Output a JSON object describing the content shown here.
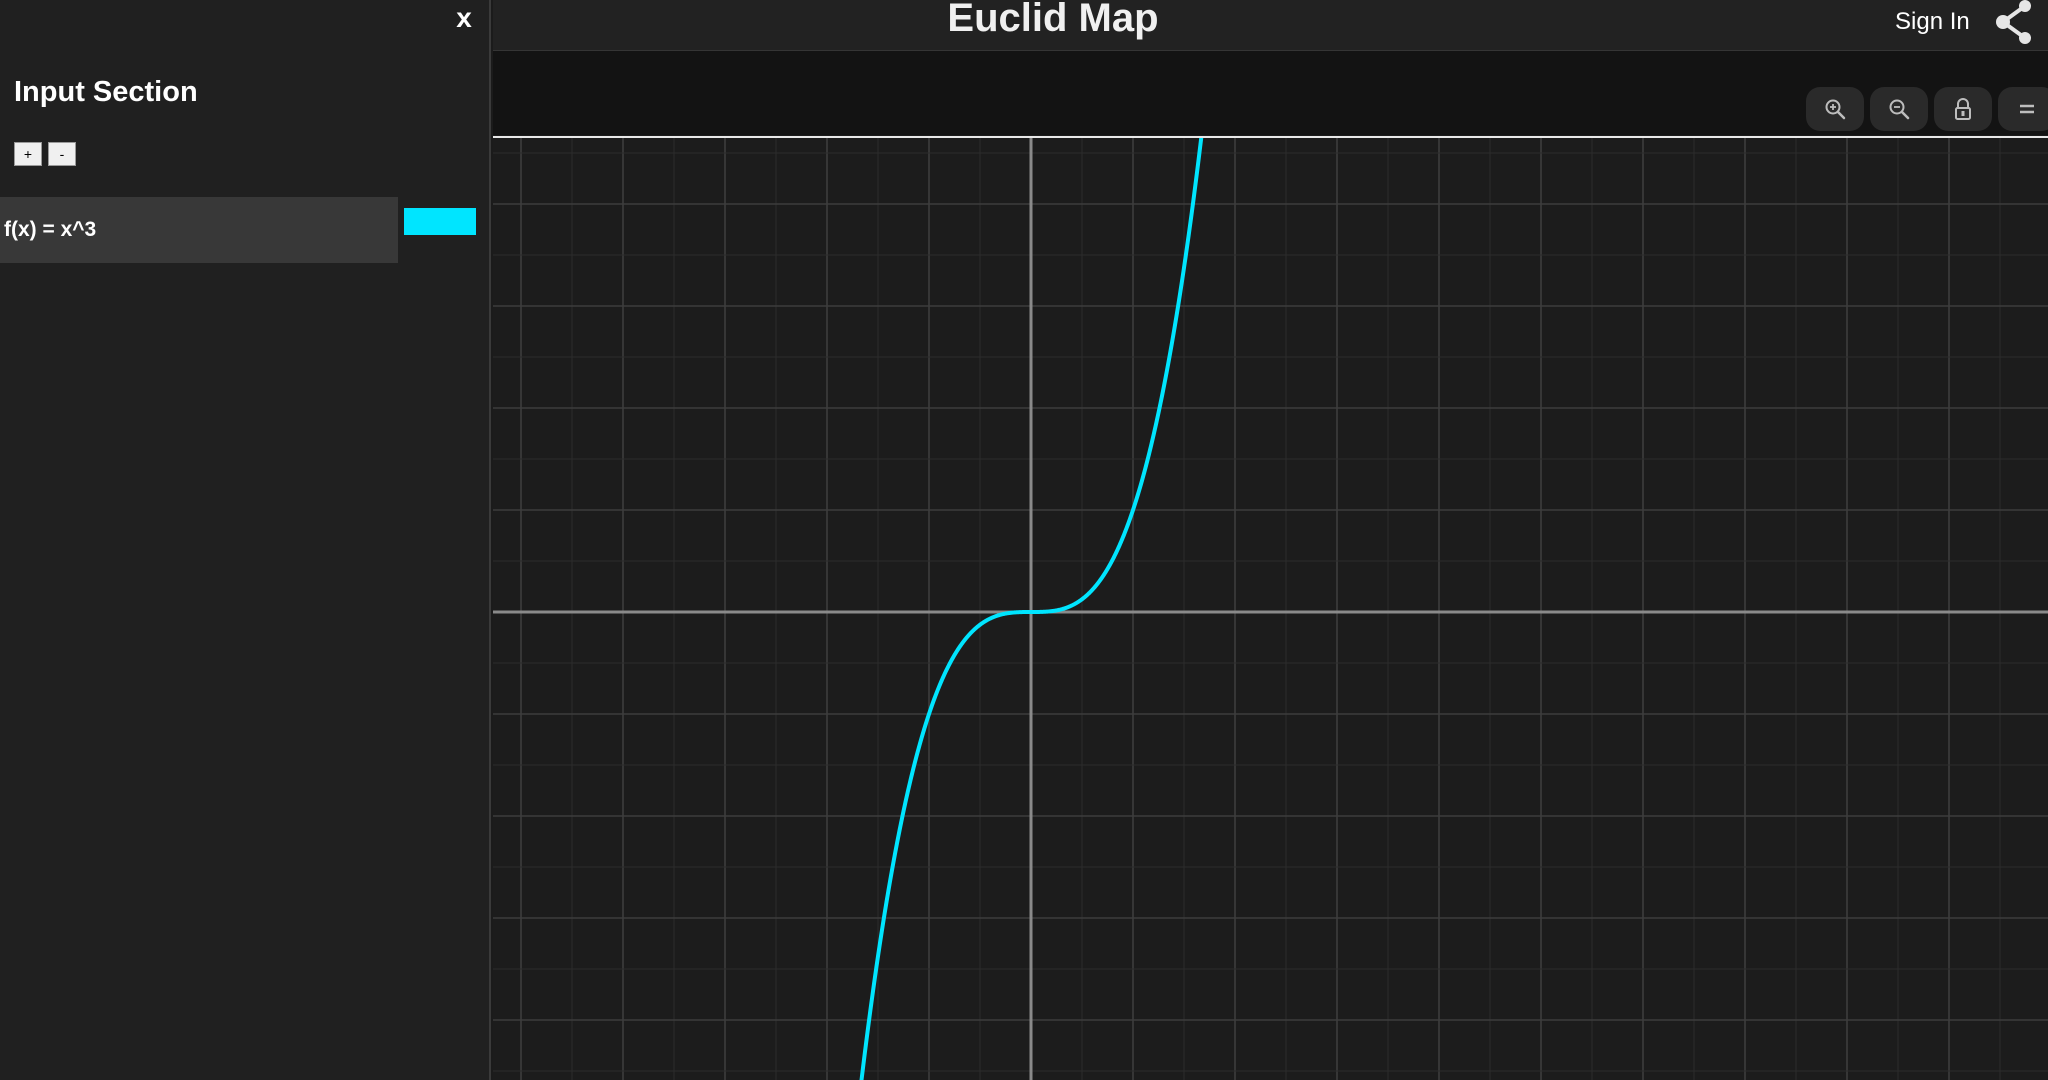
{
  "sidebar": {
    "close_label": "x",
    "title": "Input Section",
    "add_label": "+",
    "remove_label": "-",
    "functions": [
      {
        "expression": "f(x) = x^3",
        "color": "#00e5ff"
      }
    ]
  },
  "header": {
    "title": "Euclid Map",
    "sign_in": "Sign In",
    "share_icon": "share-icon"
  },
  "toolbar": {
    "buttons": [
      "zoom-in-icon",
      "zoom-out-icon",
      "lock-icon",
      "menu-icon"
    ]
  },
  "chart_data": {
    "type": "line",
    "title": "",
    "xlabel": "",
    "ylabel": "",
    "grid": true,
    "series": [
      {
        "expression": "x^3",
        "color": "#00e5ff"
      }
    ]
  },
  "colors": {
    "accent": "#00e5ff",
    "background": "#1b1b1b",
    "sidebar": "#202020",
    "toolbar": "#131313"
  }
}
